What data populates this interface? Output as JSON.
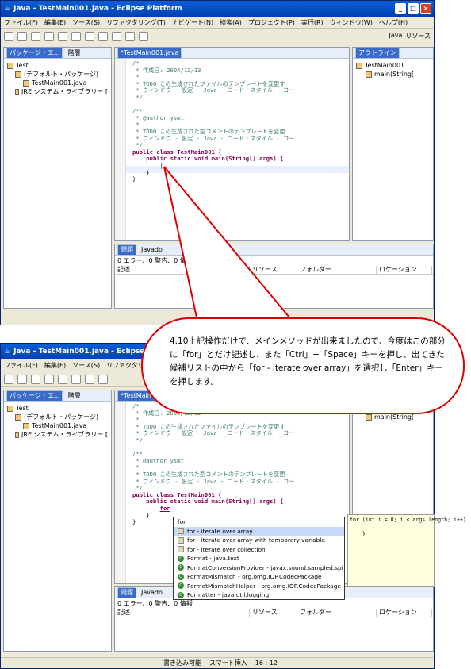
{
  "window": {
    "title": "Java - TestMain001.java - Eclipse Platform"
  },
  "menu": [
    "ファイル(F)",
    "編集(E)",
    "ソース(S)",
    "リファクタリング(T)",
    "ナビゲート(N)",
    "検索(A)",
    "プロジェクト(P)",
    "実行(R)",
    "ウィンドウ(W)",
    "ヘルプ(H)"
  ],
  "perspectives": [
    "Java",
    "リソース"
  ],
  "package_explorer": {
    "tabs": [
      "パッケージ・エ...",
      "階層"
    ],
    "items": [
      "Test",
      "(デフォルト・パッケージ)",
      "TestMain001.java",
      "JRE システム・ライブラリー ["
    ]
  },
  "editor": {
    "tab": "*TestMain001.java",
    "lines": [
      "/*",
      " * 作成日: 2004/12/13",
      " *",
      " * TODO この生成されたファイルのテンプレートを変更す",
      " * ウィンドウ - 設定 - Java - コード・スタイル - コー",
      " */",
      "",
      "/**",
      " * @author ysmt",
      " *",
      " * TODO この生成された型コメントのテンプレートを変更",
      " * ウィンドウ - 設定 - Java - コード・スタイル - コー",
      " */",
      "public class TestMain001 {",
      "    public static void main(String[] args) {",
      "        |",
      "    }",
      "}"
    ],
    "typed": "for"
  },
  "outline": {
    "tab": "アウトライン",
    "items": [
      "TestMain001",
      "main(String["
    ]
  },
  "problems": {
    "tabs": [
      "問題",
      "Javado"
    ],
    "summary": "0 エラー、0 警告、0 情報",
    "columns": [
      "記述",
      "リソース",
      "フォルダー",
      "ロケーション"
    ]
  },
  "completion": [
    "for",
    "for - iterate over array",
    "for - iterate over array with temporary variable",
    "for - iterate over collection",
    "Format - java.text",
    "FormatConversionProvider - javax.sound.sampled.spi",
    "FormatMismatch - org.omg.IOP.CodecPackage",
    "FormatMismatchHelper - org.omg.IOP.CodecPackage",
    "Formatter - java.util.logging"
  ],
  "preview": "for (int i = 0; i < args.length; i++)\n\n    }",
  "status": [
    "書き込み可能",
    "スマート挿入",
    "16 : 12"
  ],
  "callout": "4.10上記操作だけで、メインメソッドが出来ましたので、今度はこの部分に「for」とだけ記述し、また「Ctrl」+「Space」キーを押し、出てきた候補リストの中から「for - iterate over array」を選択し「Enter」キーを押します。"
}
